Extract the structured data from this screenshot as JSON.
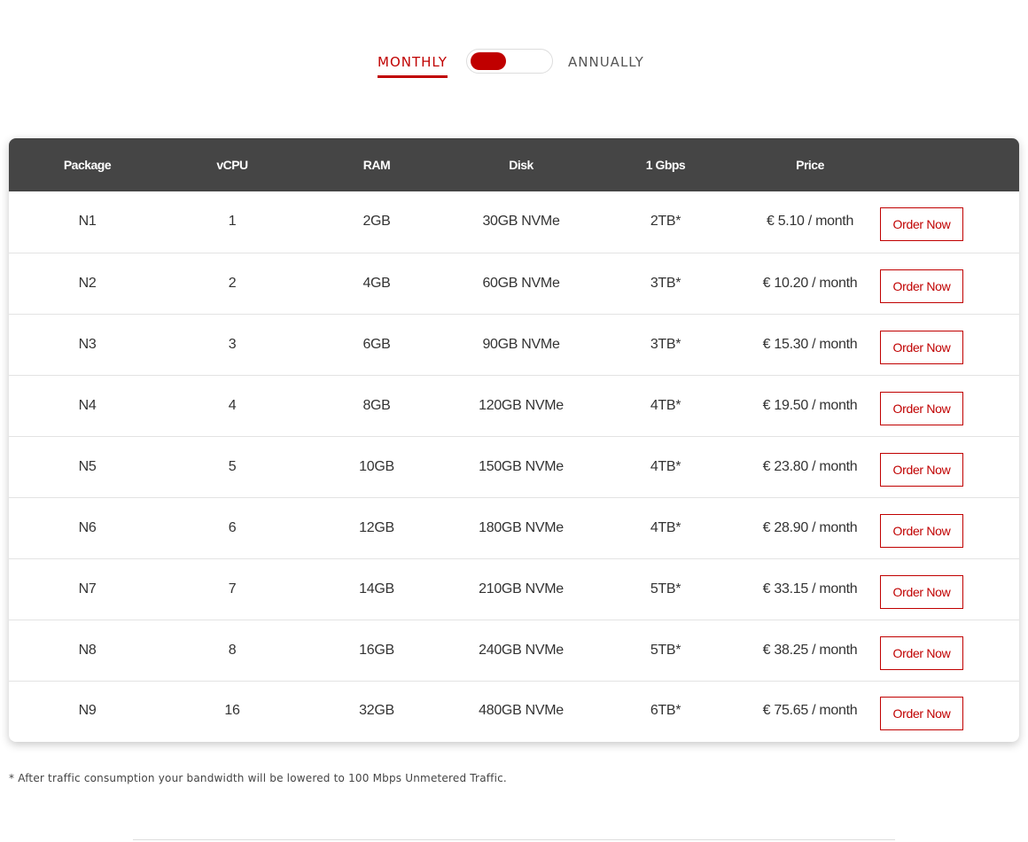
{
  "billing": {
    "monthly_label": "MONTHLY",
    "annually_label": "ANNUALLY",
    "selected": "monthly"
  },
  "table": {
    "headers": [
      "Package",
      "vCPU",
      "RAM",
      "Disk",
      "1 Gbps",
      "Price",
      ""
    ],
    "order_label": "Order Now",
    "rows": [
      {
        "package": "N1",
        "vcpu": "1",
        "ram": "2GB",
        "disk": "30GB NVMe",
        "traffic": "2TB*",
        "price": "€ 5.10 / month"
      },
      {
        "package": "N2",
        "vcpu": "2",
        "ram": "4GB",
        "disk": "60GB NVMe",
        "traffic": "3TB*",
        "price": "€ 10.20 / month"
      },
      {
        "package": "N3",
        "vcpu": "3",
        "ram": "6GB",
        "disk": "90GB NVMe",
        "traffic": "3TB*",
        "price": "€ 15.30 / month"
      },
      {
        "package": "N4",
        "vcpu": "4",
        "ram": "8GB",
        "disk": "120GB NVMe",
        "traffic": "4TB*",
        "price": "€ 19.50 / month"
      },
      {
        "package": "N5",
        "vcpu": "5",
        "ram": "10GB",
        "disk": "150GB NVMe",
        "traffic": "4TB*",
        "price": "€ 23.80 / month"
      },
      {
        "package": "N6",
        "vcpu": "6",
        "ram": "12GB",
        "disk": "180GB NVMe",
        "traffic": "4TB*",
        "price": "€ 28.90 / month"
      },
      {
        "package": "N7",
        "vcpu": "7",
        "ram": "14GB",
        "disk": "210GB NVMe",
        "traffic": "5TB*",
        "price": "€ 33.15 / month"
      },
      {
        "package": "N8",
        "vcpu": "8",
        "ram": "16GB",
        "disk": "240GB NVMe",
        "traffic": "5TB*",
        "price": "€ 38.25 / month"
      },
      {
        "package": "N9",
        "vcpu": "16",
        "ram": "32GB",
        "disk": "480GB NVMe",
        "traffic": "6TB*",
        "price": "€ 75.65 / month"
      }
    ]
  },
  "footnote": "* After traffic consumption your bandwidth will be lowered to 100 Mbps Unmetered Traffic.",
  "colors": {
    "accent": "#c00000",
    "header_bg": "#454545"
  }
}
